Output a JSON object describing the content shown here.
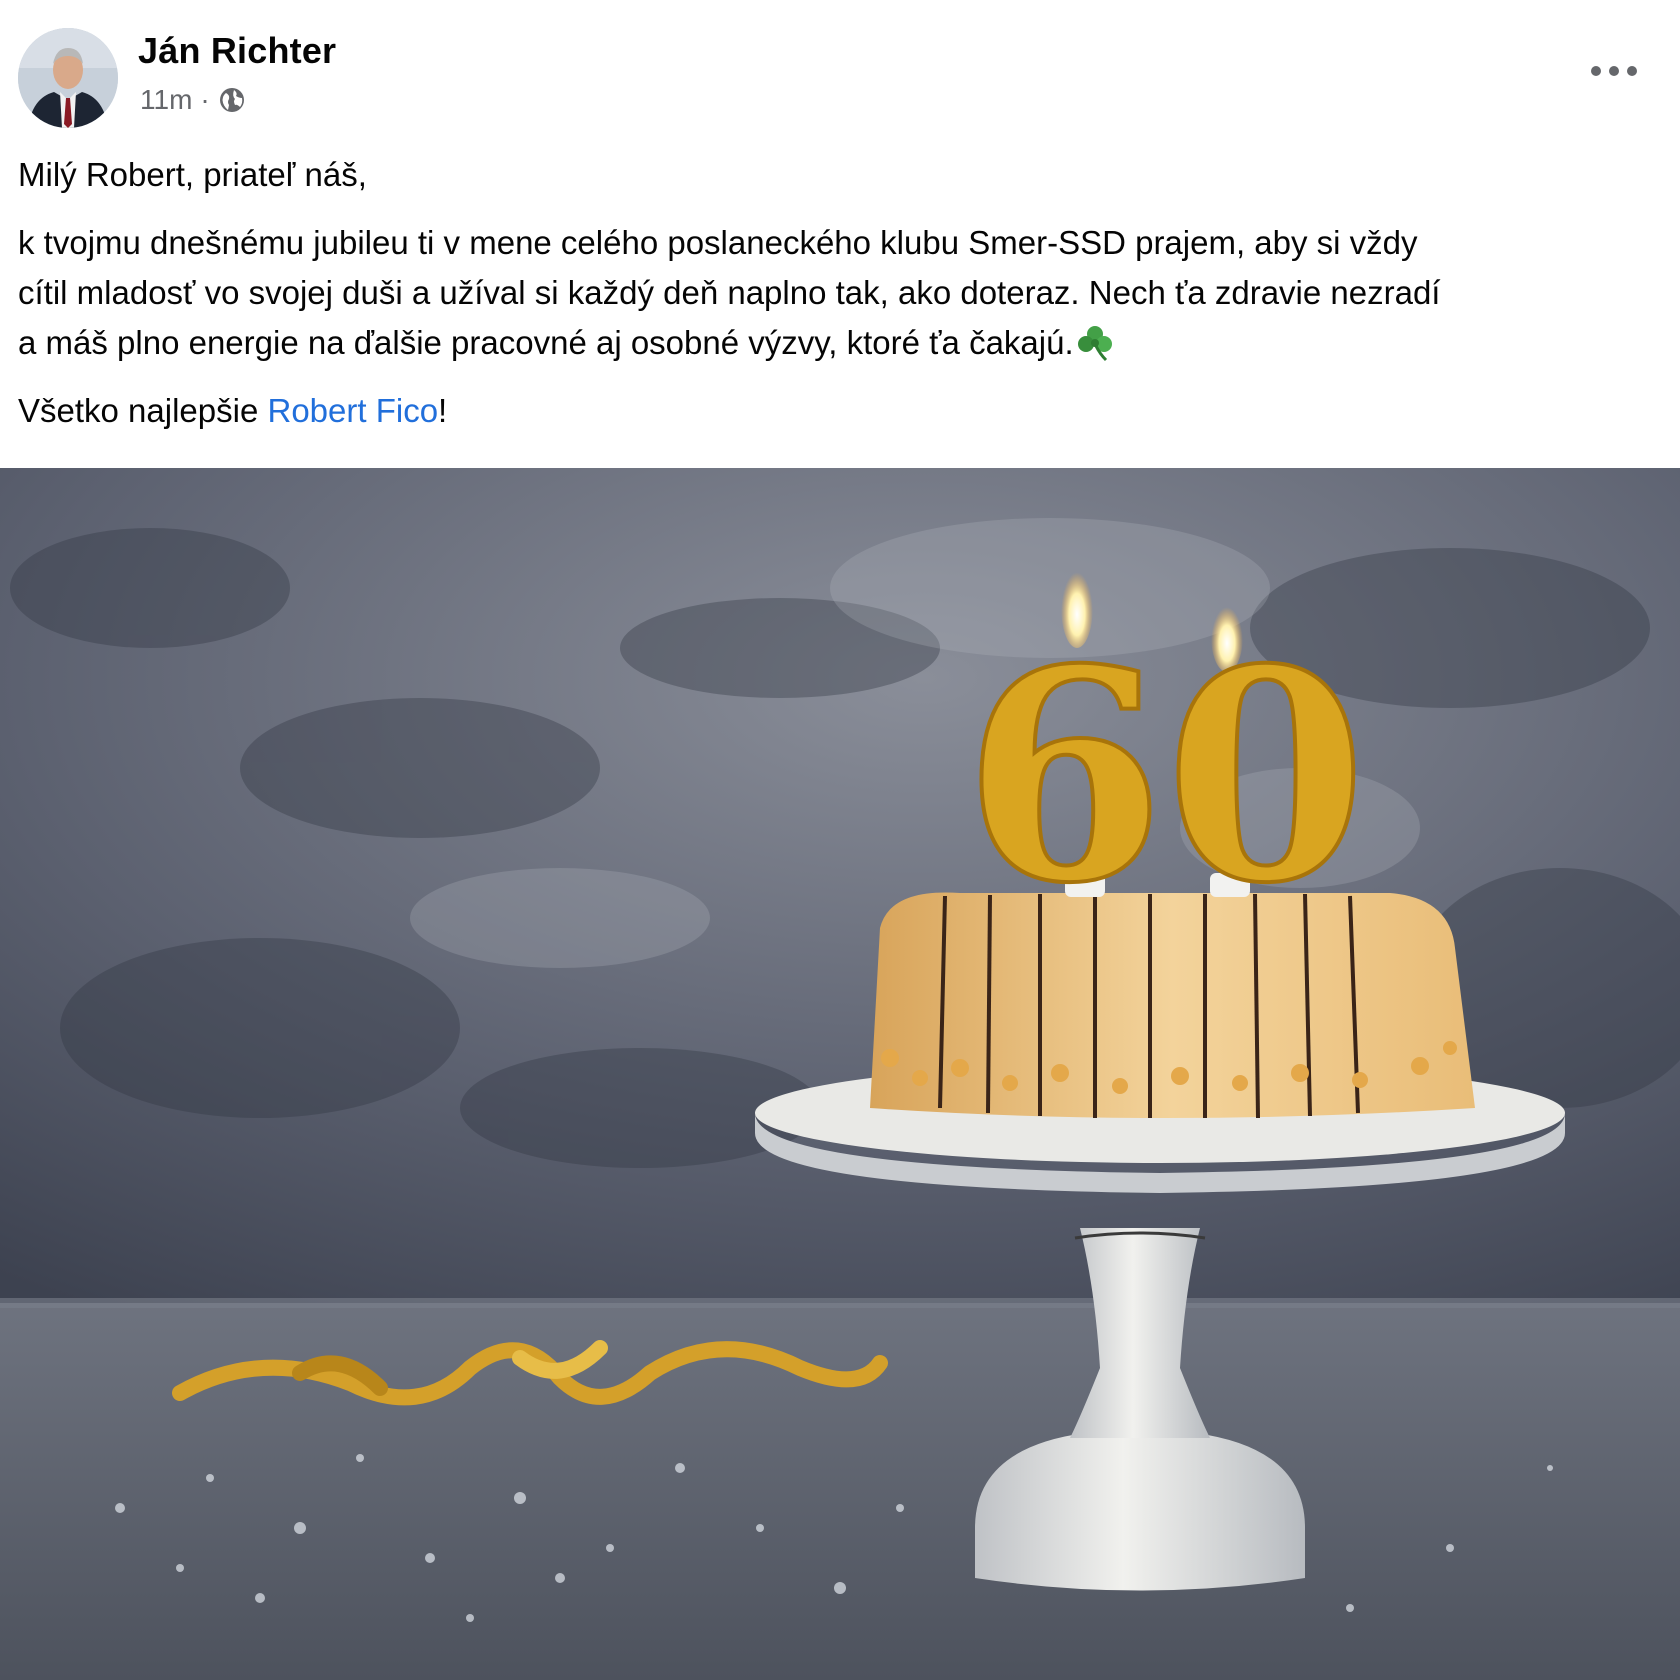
{
  "post": {
    "author": "Ján Richter",
    "time": "11m",
    "separator": "·",
    "audience_icon": "globe-icon",
    "more_icon": "more-options-icon",
    "text": {
      "greeting": "Milý Robert, priateľ náš,",
      "message_line1": "k tvojmu dnešnému jubileu ti v mene celého poslaneckého klubu Smer-SSD prajem, aby si vždy",
      "message_line2": "cítil mladosť vo svojej duši a užíval si každý deň naplno tak, ako doteraz. Nech ťa zdravie nezradí",
      "message_line3": "a máš plno energie na ďalšie pracovné aj osobné výzvy, ktoré ťa čakajú.",
      "emoji_icon": "shamrock-icon",
      "closing_prefix": "Všetko najlepšie ",
      "mention": "Robert Fico",
      "closing_suffix": "!"
    },
    "image": {
      "candle_number": "60"
    }
  },
  "colors": {
    "mention": "#216fdb",
    "secondary_text": "#65676b",
    "gold": "#d9a520"
  }
}
